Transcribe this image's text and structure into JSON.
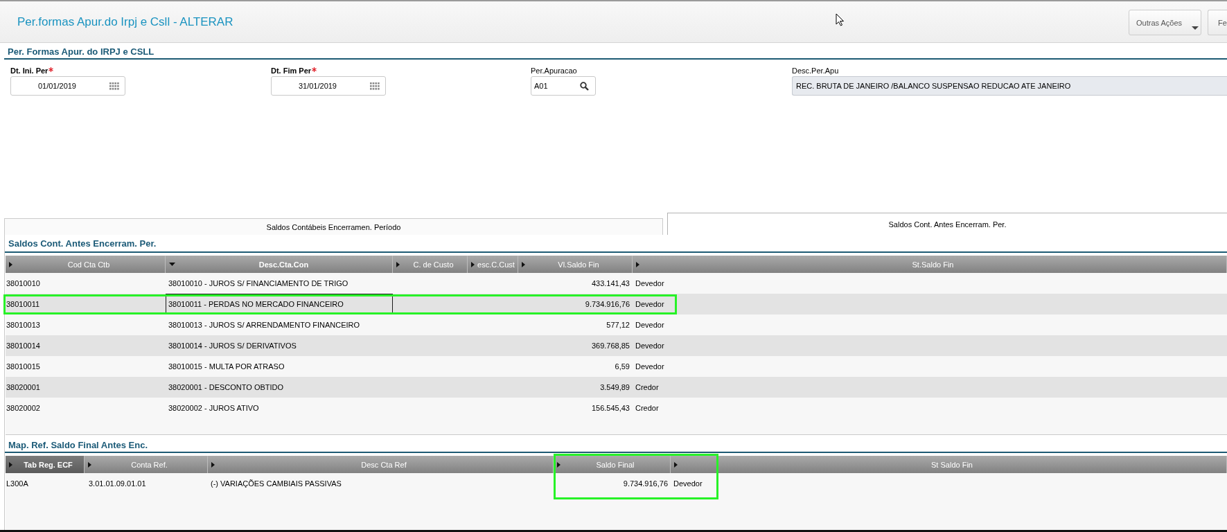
{
  "header": {
    "title": "Per.formas Apur.do Irpj e Csll - ALTERAR",
    "buttons": [
      {
        "label": "Outras Ações",
        "kind": "menu"
      },
      {
        "label": "Fe",
        "kind": "plain"
      }
    ]
  },
  "form": {
    "title": "Per. Formas Apur. do IRPJ e CSLL",
    "fields": [
      {
        "label": "Dt. Ini. Per",
        "required": true,
        "kind": "date",
        "value": "01/01/2019",
        "disabled": false
      },
      {
        "label": "Dt. Fim Per",
        "required": true,
        "kind": "date",
        "value": "31/01/2019",
        "disabled": false
      },
      {
        "label": "Per.Apuracao",
        "required": false,
        "kind": "lookup",
        "value": "A01",
        "disabled": false
      },
      {
        "label": "Desc.Per.Apu",
        "required": false,
        "kind": "text",
        "value": "REC. BRUTA DE JANEIRO /BALANCO SUSPENSAO REDUCAO ATE JANEIRO",
        "disabled": true
      }
    ]
  },
  "tabs": [
    {
      "label": "Saldos Contábeis Encerramen. Período",
      "selected": false
    },
    {
      "label": "Saldos Cont. Antes Encerram. Per.",
      "selected": true
    }
  ],
  "upper_grid": {
    "title": "Saldos Cont. Antes Encerram. Per.",
    "columns": [
      {
        "label": "Cod Cta Ctb",
        "sorted": false,
        "active": false
      },
      {
        "label": "Desc.Cta.Con",
        "sorted": true,
        "active": false
      },
      {
        "label": "C. de Custo",
        "sorted": false,
        "active": false
      },
      {
        "label": "esc.C.Cust",
        "sorted": false,
        "active": false
      },
      {
        "label": "Vl.Saldo Fin",
        "sorted": false,
        "active": false
      },
      {
        "label": "St.Saldo Fin",
        "sorted": false,
        "active": false
      }
    ],
    "rows": [
      {
        "cod": "38010010",
        "desc": "38010010 - JUROS S/ FINANCIAMENTO DE TRIGO",
        "saldo": "433.141,43",
        "status": "Devedor",
        "focused": false,
        "highlighted": false
      },
      {
        "cod": "38010011",
        "desc": "38010011 - PERDAS NO MERCADO FINANCEIRO",
        "saldo": "9.734.916,76",
        "status": "Devedor",
        "focused": true,
        "highlighted": true
      },
      {
        "cod": "38010013",
        "desc": "38010013 - JUROS S/ ARRENDAMENTO FINANCEIRO",
        "saldo": "577,12",
        "status": "Devedor",
        "focused": false,
        "highlighted": false
      },
      {
        "cod": "38010014",
        "desc": "38010014 - JUROS S/ DERIVATIVOS",
        "saldo": "369.768,85",
        "status": "Devedor",
        "focused": false,
        "highlighted": false
      },
      {
        "cod": "38010015",
        "desc": "38010015 - MULTA POR ATRASO",
        "saldo": "6,59",
        "status": "Devedor",
        "focused": false,
        "highlighted": false
      },
      {
        "cod": "38020001",
        "desc": "38020001 - DESCONTO OBTIDO",
        "saldo": "3.549,89",
        "status": "Credor",
        "focused": false,
        "highlighted": false
      },
      {
        "cod": "38020002",
        "desc": "38020002 - JUROS ATIVO",
        "saldo": "156.545,43",
        "status": "Credor",
        "focused": false,
        "highlighted": false
      }
    ]
  },
  "lower_grid": {
    "title": "Map. Ref. Saldo Final Antes Enc.",
    "columns": [
      {
        "label": "Tab Reg. ECF",
        "sorted": false,
        "active": true,
        "highlighted": false
      },
      {
        "label": "Conta Ref.",
        "sorted": false,
        "active": false,
        "highlighted": false
      },
      {
        "label": "Desc Cta Ref",
        "sorted": false,
        "active": false,
        "highlighted": false
      },
      {
        "label": "Saldo Final",
        "sorted": false,
        "active": false,
        "highlighted": true
      },
      {
        "label": "St Saldo Fin",
        "sorted": false,
        "active": false,
        "highlighted": false
      }
    ],
    "rows": [
      {
        "tab_reg": "L300A",
        "conta_ref": "3.01.01.09.01.01",
        "desc": "(-) VARIAÇÕES CAMBIAIS PASSIVAS",
        "saldo": "9.734.916,76",
        "status": "Devedor"
      }
    ]
  }
}
